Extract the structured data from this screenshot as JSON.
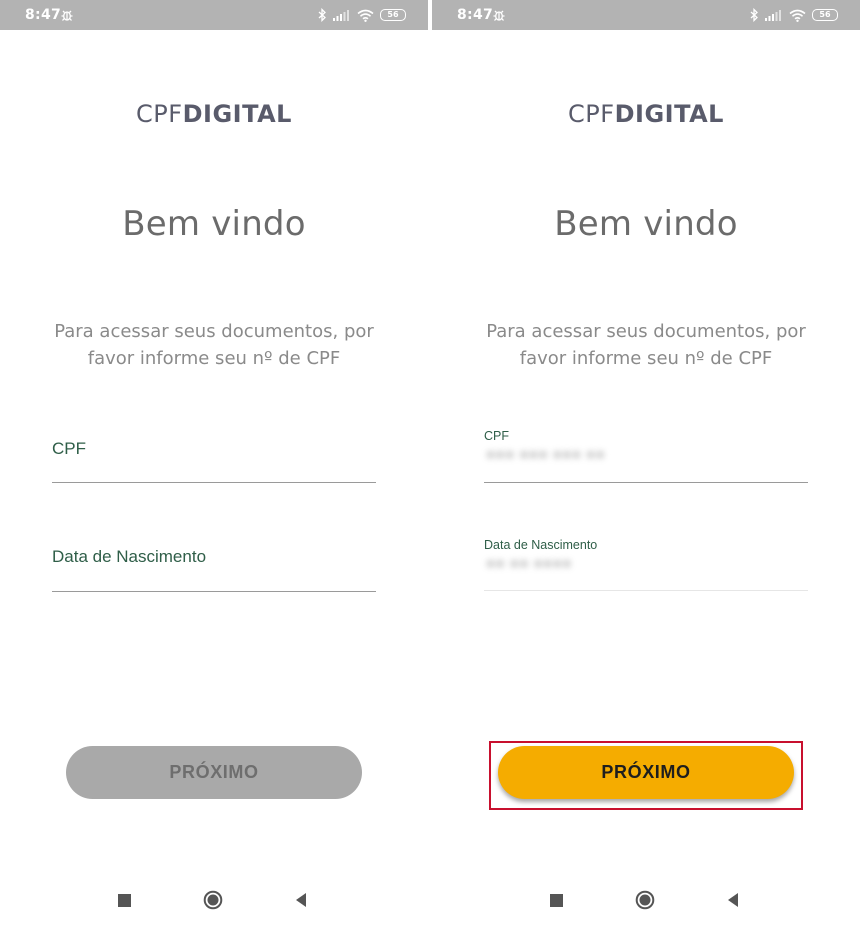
{
  "screens": [
    {
      "status_bar": {
        "time": "8:47",
        "battery": "56"
      },
      "logo": {
        "light": "CPF",
        "bold": "DIGITAL"
      },
      "welcome": "Bem vindo",
      "instructions": "Para acessar seus documentos, por favor informe seu nº de CPF",
      "cpf_field": {
        "label": "CPF",
        "value": ""
      },
      "birthdate_field": {
        "label": "Data de Nascimento",
        "value": ""
      },
      "next_button": {
        "label": "PRÓXIMO",
        "state": "disabled"
      }
    },
    {
      "status_bar": {
        "time": "8:47",
        "battery": "56"
      },
      "logo": {
        "light": "CPF",
        "bold": "DIGITAL"
      },
      "welcome": "Bem vindo",
      "instructions": "Para acessar seus documentos, por favor informe seu nº de CPF",
      "cpf_field": {
        "label": "CPF",
        "value": "●●● ●●● ●●● ●●"
      },
      "birthdate_field": {
        "label": "Data de Nascimento",
        "value": "●● ●● ●●●●"
      },
      "next_button": {
        "label": "PRÓXIMO",
        "state": "enabled"
      }
    }
  ],
  "colors": {
    "status_bar": "#b3b3b3",
    "logo": "#595b6b",
    "field_label": "#2f5e48",
    "button_disabled": "#a9a9a9",
    "button_enabled": "#f5ac00",
    "highlight": "#c8102e"
  },
  "icons": {
    "status": [
      "bug-icon",
      "bluetooth-icon",
      "signal-icon",
      "wifi-icon",
      "battery-icon"
    ],
    "nav": [
      "recents-square-icon",
      "home-circle-icon",
      "back-triangle-icon"
    ]
  }
}
